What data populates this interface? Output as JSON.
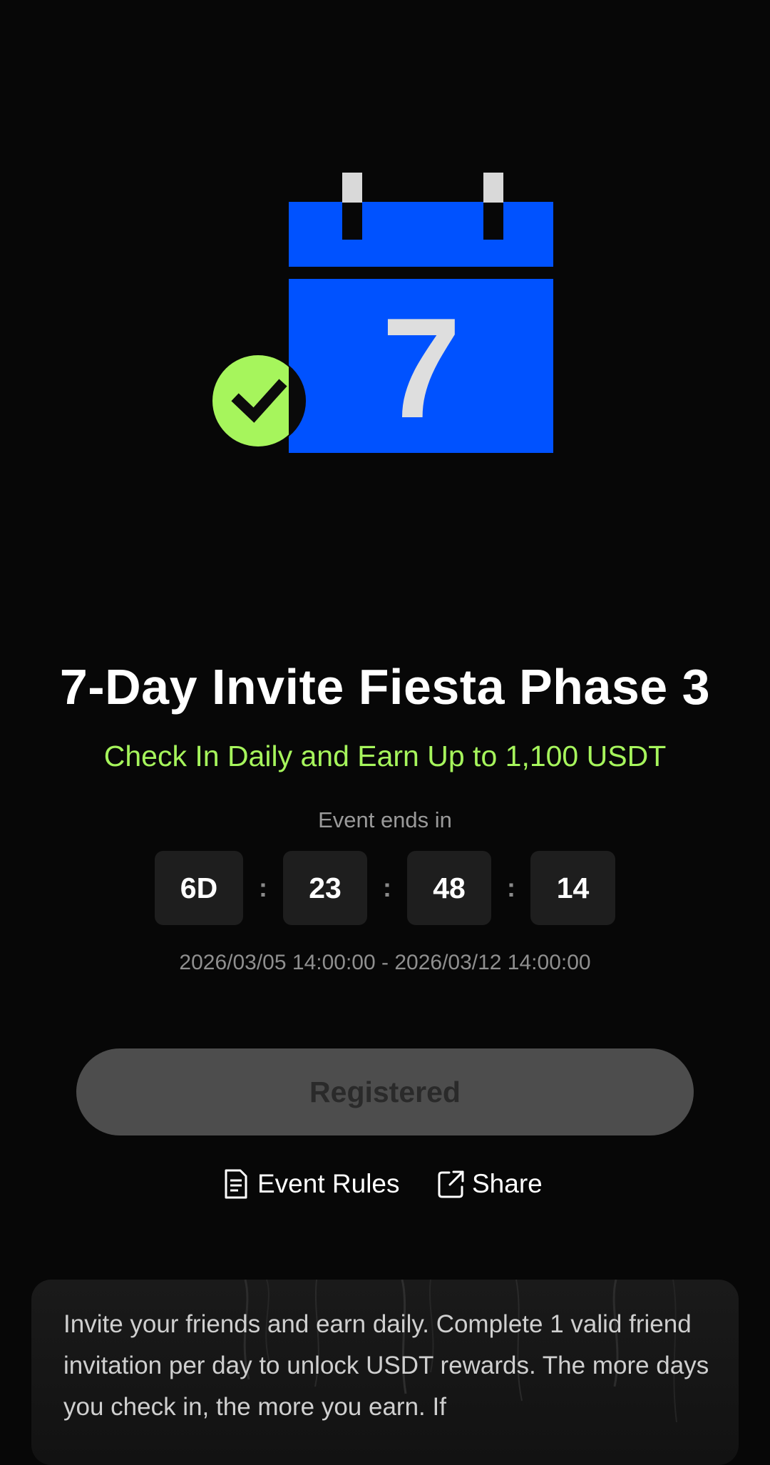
{
  "hero": {
    "calendar_day": "7",
    "colors": {
      "calendar_blue": "#0052ff",
      "check_green": "#a6f55c",
      "ring_gray": "#d9d9d9"
    }
  },
  "title": "7-Day Invite Fiesta Phase 3",
  "subtitle": "Check In Daily and Earn Up to 1,100 USDT",
  "countdown": {
    "label": "Event ends in",
    "days": "6D",
    "hours": "23",
    "minutes": "48",
    "seconds": "14",
    "separator": ":"
  },
  "event_range": "2026/03/05 14:00:00 - 2026/03/12 14:00:00",
  "register_button": "Registered",
  "links": {
    "rules": "Event Rules",
    "share": "Share"
  },
  "description": "Invite your friends and earn daily. Complete 1 valid friend invitation per day to unlock USDT rewards. The more days you check in, the more you earn. If"
}
